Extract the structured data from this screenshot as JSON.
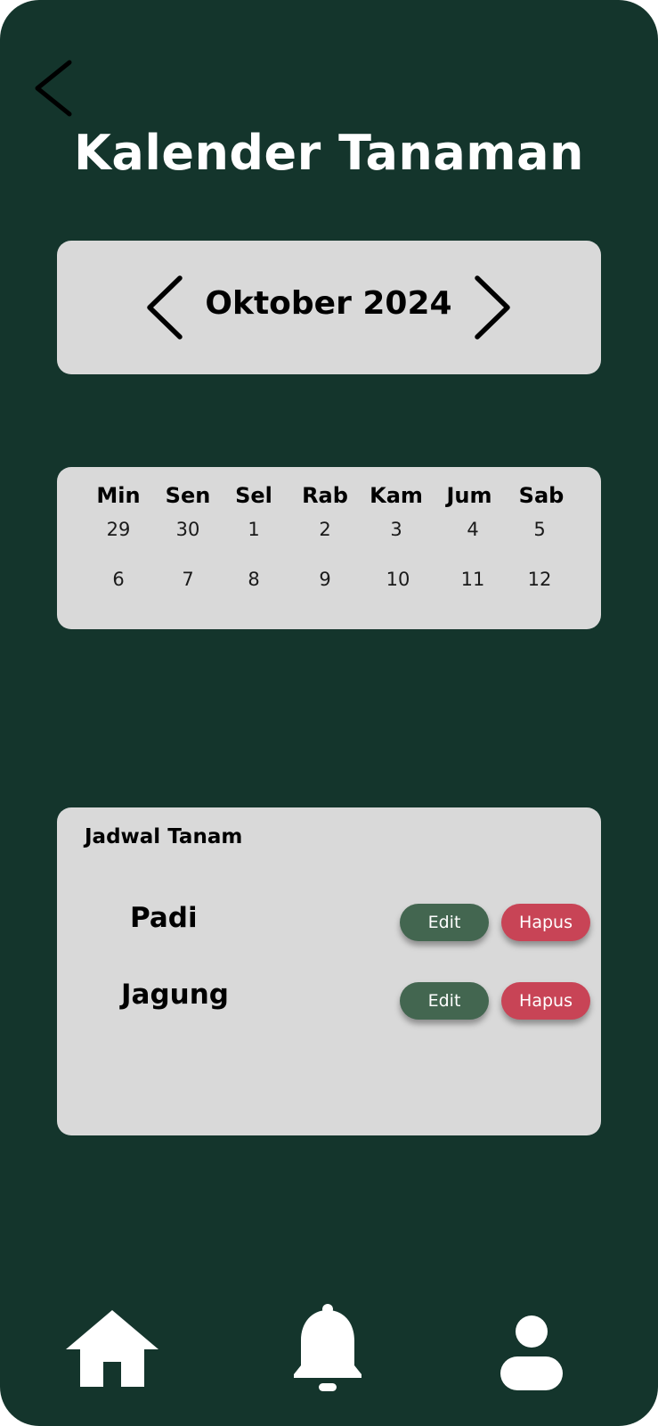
{
  "header": {
    "title": "Kalender Tanaman",
    "back_icon": "chevron-left-icon"
  },
  "month_picker": {
    "label": "Oktober 2024",
    "prev_icon": "chevron-left-icon",
    "next_icon": "chevron-right-icon"
  },
  "calendar": {
    "weekdays": [
      "Min",
      "Sen",
      "Sel",
      "Rab",
      "Kam",
      "Jum",
      "Sab"
    ],
    "weeks": [
      [
        "29",
        "30",
        "1",
        "2",
        "3",
        "4",
        "5"
      ],
      [
        "6",
        "7",
        "8",
        "9",
        "10",
        "11",
        "12"
      ]
    ]
  },
  "schedule": {
    "title": "Jadwal Tanam",
    "items": [
      {
        "name": "Padi",
        "edit_label": "Edit",
        "delete_label": "Hapus"
      },
      {
        "name": "Jagung",
        "edit_label": "Edit",
        "delete_label": "Hapus"
      }
    ]
  },
  "tabbar": {
    "items": [
      {
        "icon": "home-icon"
      },
      {
        "icon": "bell-icon"
      },
      {
        "icon": "user-icon"
      }
    ]
  },
  "colors": {
    "background": "#14352c",
    "card": "#d9d9d9",
    "edit_button": "#436650",
    "delete_button": "#c84456",
    "text_light": "#ffffff",
    "text_dark": "#000000"
  }
}
